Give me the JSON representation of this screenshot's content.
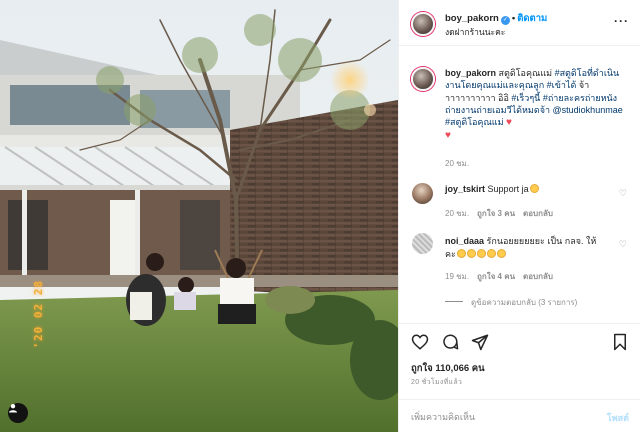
{
  "header": {
    "username": "boy_pakorn",
    "follow_label": "ติดตาม",
    "location": "งดฝากร้านนะคะ",
    "more_icon": "more-options-icon"
  },
  "photo": {
    "date_stamp": "'20 02 28"
  },
  "caption": {
    "username": "boy_pakorn",
    "body": "สตูดิโอคุณแม่ ",
    "hashtag_1": "#สตูดิโอที่ดำเนินงานโดยคุณแม่และคุณลูก",
    "hashtag_2": " #เข้าได้",
    "text_2": " จ้าาาาาาาาาาา อิอิ ",
    "hashtag_3": "#เร็วๆนี้",
    "hashtag_4": " #ถ่ายละครถ่ายหนังถ่ายงานถ่ายเอมวีได้หมดจ้า",
    "mention": " @studiokhunmae",
    "hashtag_5": " #สตูดิโอคุณแม่",
    "time": "20 ชม."
  },
  "comments": [
    {
      "username": "joy_tskirt",
      "text": "Support ja",
      "time": "20 ชม.",
      "likes": "ถูกใจ 3 คน",
      "reply": "ตอบกลับ"
    },
    {
      "username": "noi_daaa",
      "text": "รักนอยยยยยยะ เป็น กลจ. ให้คะ",
      "time": "19 ชม.",
      "likes": "ถูกใจ 4 คน",
      "reply": "ตอบกลับ"
    }
  ],
  "view_replies": "ดูข้อความตอบกลับ (3 รายการ)",
  "actions": {
    "likes": "ถูกใจ 110,066 คน",
    "time_ago": "20 ชั่วโมงที่แล้ว"
  },
  "add_comment": {
    "placeholder": "เพิ่มความคิดเห็น",
    "post_label": "โพสต์"
  },
  "colors": {
    "link_blue": "#0095f6",
    "hashtag": "#00376b",
    "heart": "#ed4956",
    "date_stamp": "#f2b13a"
  }
}
